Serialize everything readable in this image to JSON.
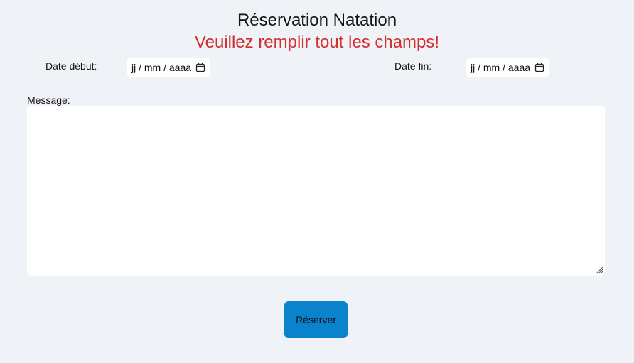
{
  "page": {
    "title": "Réservation Natation",
    "error": "Veuillez remplir tout les champs!"
  },
  "form": {
    "start_label": "Date début:",
    "start_placeholder": "jj / mm / aaaa",
    "end_label": "Date fin:",
    "end_placeholder": "jj / mm / aaaa",
    "message_label": "Message:",
    "message_value": "",
    "submit_label": "Réserver"
  },
  "icons": {
    "date_picker": "calendar-icon",
    "resize": "resize-grip-icon"
  },
  "colors": {
    "background": "#eff2f7",
    "error": "#d42f2f",
    "button": "#0a83cc"
  }
}
